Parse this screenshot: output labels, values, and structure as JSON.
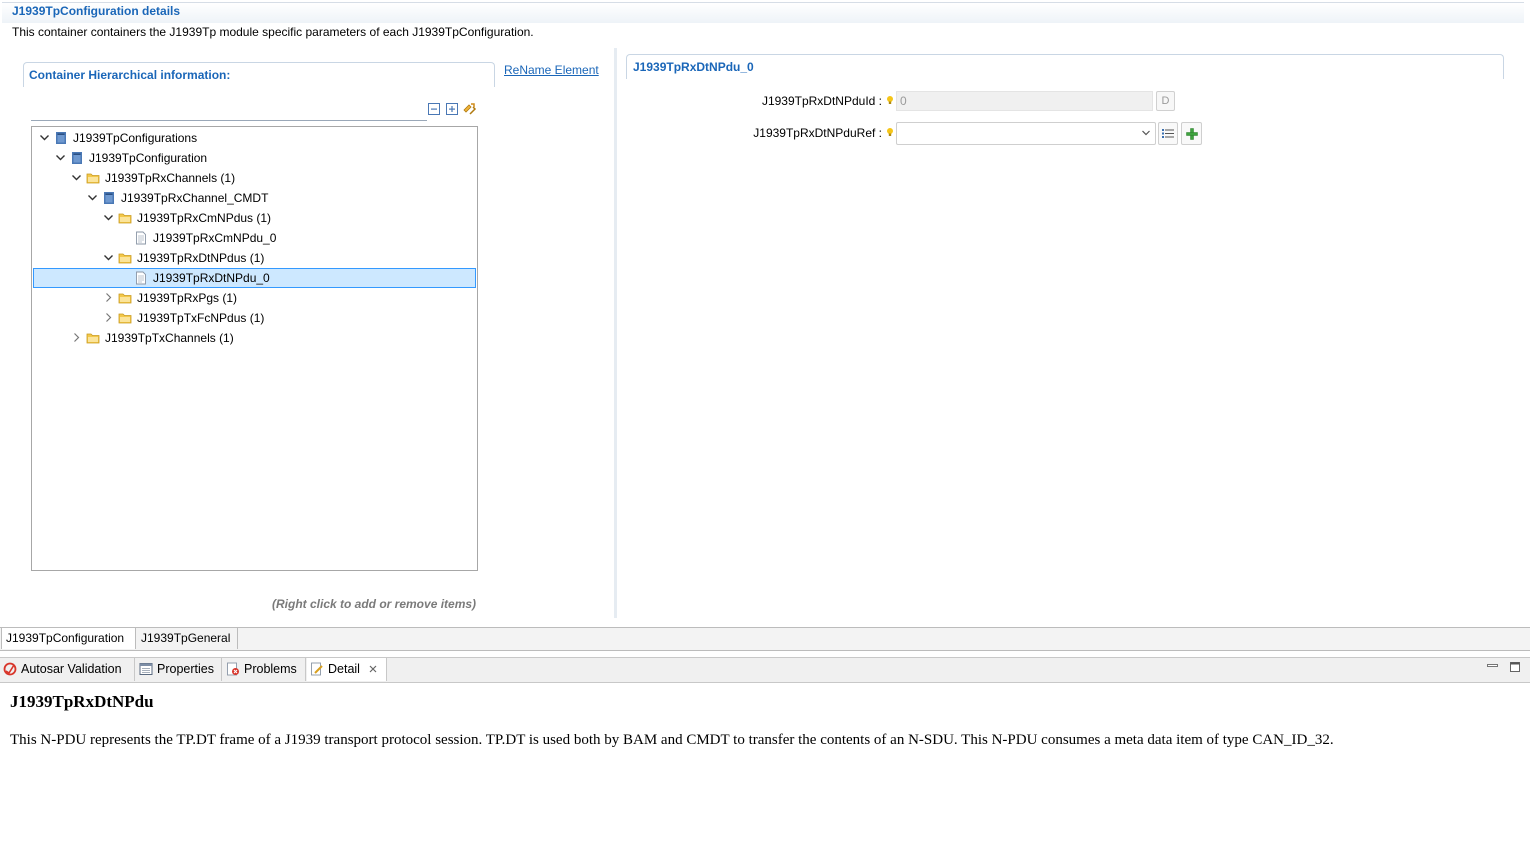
{
  "header": {
    "title": "J1939TpConfiguration details",
    "description": "This container containers the J1939Tp module specific parameters of each J1939TpConfiguration."
  },
  "left_panel": {
    "section_title": "Container Hierarchical information:",
    "rename_link": "ReName Element",
    "filter_value": "",
    "toolbar_icons": [
      "collapse-all-icon",
      "expand-all-icon",
      "sync-icon"
    ],
    "tree": [
      {
        "label": "J1939TpConfigurations",
        "icon": "container-icon",
        "expanded": true
      },
      {
        "label": "J1939TpConfiguration",
        "icon": "container-icon",
        "expanded": true
      },
      {
        "label": "J1939TpRxChannels (1)",
        "icon": "folder-icon",
        "expanded": true
      },
      {
        "label": "J1939TpRxChannel_CMDT",
        "icon": "container-icon",
        "expanded": true
      },
      {
        "label": "J1939TpRxCmNPdus (1)",
        "icon": "folder-icon",
        "expanded": true
      },
      {
        "label": "J1939TpRxCmNPdu_0",
        "icon": "document-icon"
      },
      {
        "label": "J1939TpRxDtNPdus (1)",
        "icon": "folder-icon",
        "expanded": true
      },
      {
        "label": "J1939TpRxDtNPdu_0",
        "icon": "document-icon",
        "selected": true
      },
      {
        "label": "J1939TpRxPgs (1)",
        "icon": "folder-icon",
        "expanded": false
      },
      {
        "label": "J1939TpTxFcNPdus (1)",
        "icon": "folder-icon",
        "expanded": false
      },
      {
        "label": "J1939TpTxChannels (1)",
        "icon": "folder-icon",
        "expanded": false
      }
    ],
    "hint": "(Right click to add or remove items)"
  },
  "right_panel": {
    "section_title": "J1939TpRxDtNPdu_0",
    "fields": {
      "npduid_label": "J1939TpRxDtNPduId :",
      "npduid_value": "0",
      "npduid_default_button": "D",
      "npduref_label": "J1939TpRxDtNPduRef :",
      "npduref_value": ""
    }
  },
  "editor_tabs": {
    "active": "J1939TpConfiguration",
    "tabs": [
      "J1939TpConfiguration",
      "J1939TpGeneral"
    ]
  },
  "views": {
    "tabs": [
      {
        "label": "Autosar Validation",
        "icon": "validation-icon"
      },
      {
        "label": "Properties",
        "icon": "properties-icon"
      },
      {
        "label": "Problems",
        "icon": "problems-icon"
      },
      {
        "label": "Detail",
        "icon": "detail-icon",
        "active": true
      }
    ]
  },
  "detail": {
    "title": "J1939TpRxDtNPdu",
    "description": "This N-PDU represents the TP.DT frame of a J1939 transport protocol session. TP.DT is used both by BAM and CMDT to transfer the contents of an N-SDU. This N-PDU consumes a meta data item of type CAN_ID_32."
  },
  "colors": {
    "title_blue": "#1a66b8",
    "selection_bg": "#cde8ff",
    "selection_border": "#3399ff",
    "folder_yellow": "#f3c84a",
    "container_blue": "#4a78b5"
  }
}
